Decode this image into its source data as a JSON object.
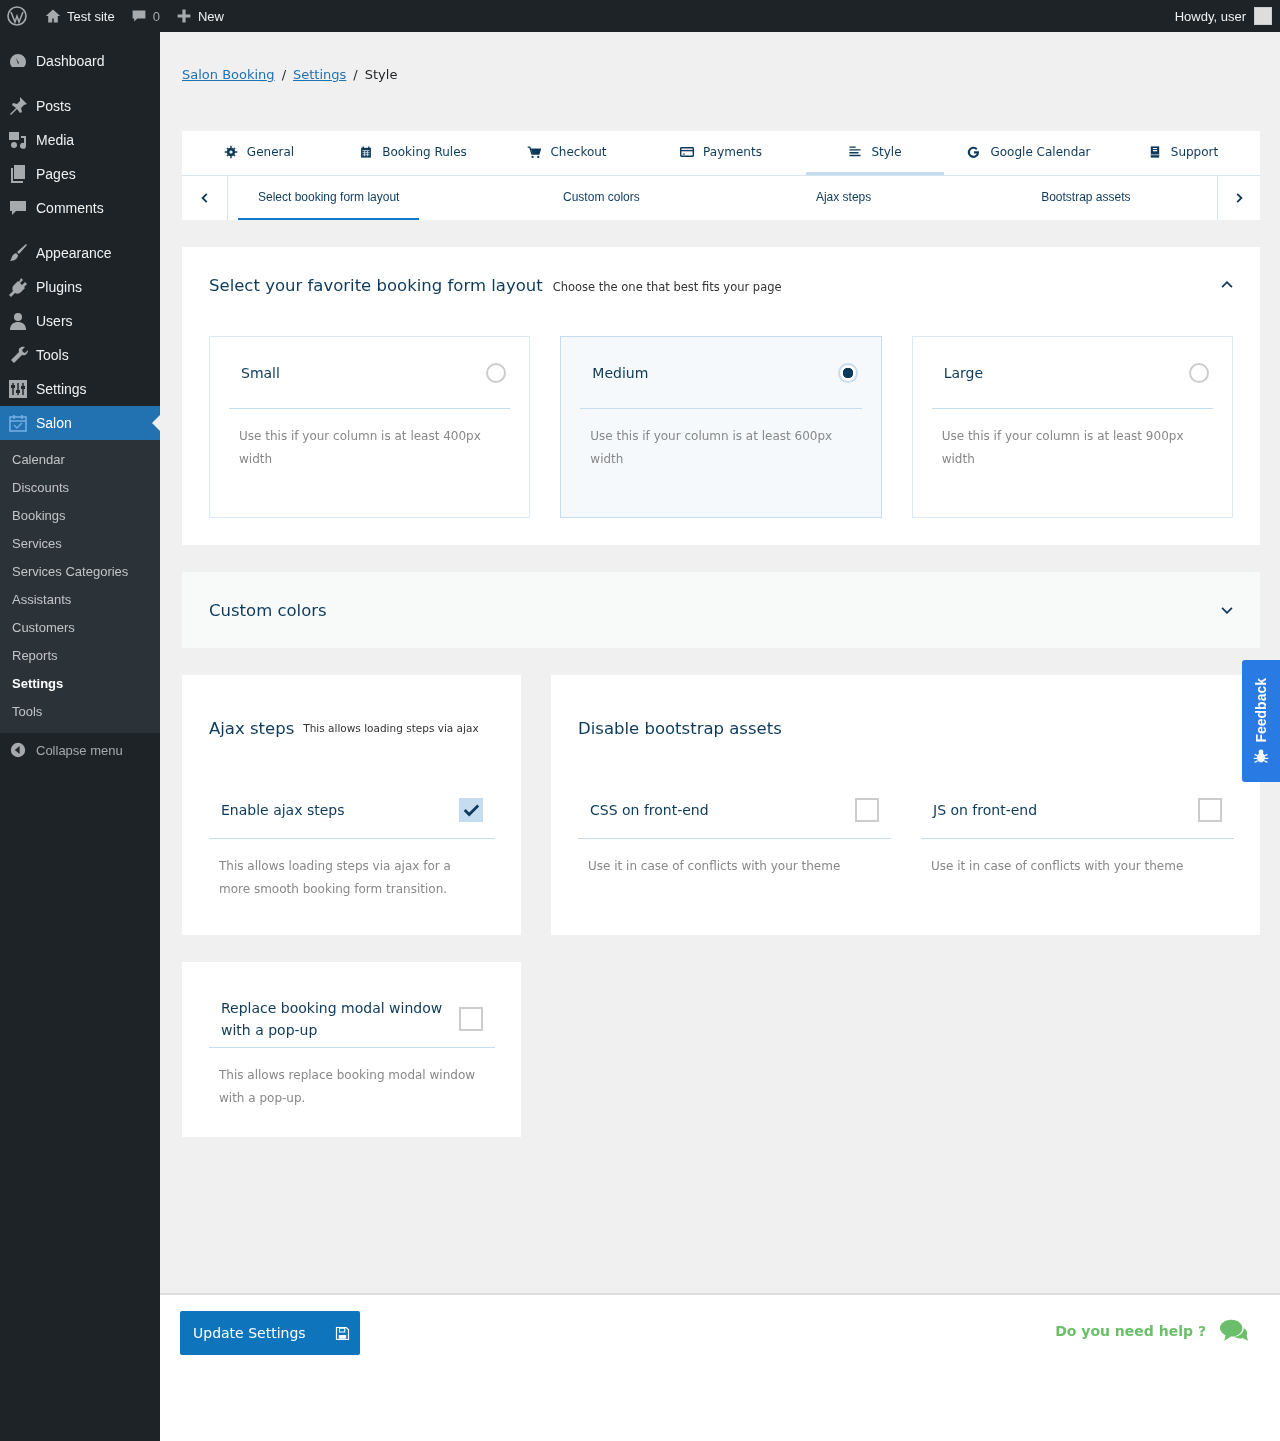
{
  "admin_bar": {
    "site": "Test site",
    "comments": "0",
    "new": "New",
    "greeting": "Howdy, user"
  },
  "sidebar": {
    "groups": [
      [
        {
          "label": "Dashboard",
          "selected": false
        }
      ],
      [
        {
          "label": "Posts",
          "selected": false
        },
        {
          "label": "Media",
          "selected": false
        },
        {
          "label": "Pages",
          "selected": false
        },
        {
          "label": "Comments",
          "selected": false
        }
      ],
      [
        {
          "label": "Appearance",
          "selected": false
        },
        {
          "label": "Plugins",
          "selected": false
        },
        {
          "label": "Users",
          "selected": false
        },
        {
          "label": "Tools",
          "selected": false
        },
        {
          "label": "Settings",
          "selected": false
        },
        {
          "label": "Salon",
          "selected": true,
          "children": [
            {
              "label": "Calendar",
              "selected": false
            },
            {
              "label": "Discounts",
              "selected": false
            },
            {
              "label": "Bookings",
              "selected": false
            },
            {
              "label": "Services",
              "selected": false
            },
            {
              "label": "Services Categories",
              "selected": false
            },
            {
              "label": "Assistants",
              "selected": false
            },
            {
              "label": "Customers",
              "selected": false
            },
            {
              "label": "Reports",
              "selected": false
            },
            {
              "label": "Settings",
              "selected": true
            },
            {
              "label": "Tools",
              "selected": false
            }
          ]
        }
      ]
    ],
    "collapse": "Collapse menu"
  },
  "breadcrumb": {
    "items": [
      {
        "label": "Salon Booking",
        "kind": "link"
      },
      {
        "label": "Settings",
        "kind": "link"
      },
      {
        "label": "Style",
        "kind": "current"
      }
    ],
    "separators": [
      "/",
      "/"
    ]
  },
  "tabs": [
    {
      "label": "General",
      "selected": false
    },
    {
      "label": "Booking Rules",
      "selected": false
    },
    {
      "label": "Checkout",
      "selected": false
    },
    {
      "label": "Payments",
      "selected": false
    },
    {
      "label": "Style",
      "selected": true
    },
    {
      "label": "Google Calendar",
      "selected": false
    },
    {
      "label": "Support",
      "selected": false
    }
  ],
  "subtabs": [
    {
      "label": "Select booking form layout",
      "selected": true
    },
    {
      "label": "Custom colors",
      "selected": false
    },
    {
      "label": "Ajax steps",
      "selected": false
    },
    {
      "label": "Bootstrap assets",
      "selected": false
    }
  ],
  "layout_section": {
    "title": "Select your favorite booking form layout",
    "subtitle": "Choose the one that best fits your page",
    "expanded": true,
    "options": [
      {
        "label": "Small",
        "description": "Use this if your column is at least 400px width",
        "selected": false
      },
      {
        "label": "Medium",
        "description": "Use this if your column is at least 600px width",
        "selected": true
      },
      {
        "label": "Large",
        "description": "Use this if your column is at least 900px width",
        "selected": false
      }
    ]
  },
  "colors_section": {
    "title": "Custom colors",
    "expanded": false
  },
  "ajax_section": {
    "title": "Ajax steps",
    "subtitle": "This allows loading steps via ajax",
    "options": [
      {
        "label": "Enable ajax steps",
        "checked": true,
        "description": "This allows loading steps via ajax for a more smooth booking form transition."
      }
    ]
  },
  "bootstrap_section": {
    "title": "Disable bootstrap assets",
    "options": [
      {
        "label": "CSS on front-end",
        "checked": false,
        "description": "Use it in case of conflicts with your theme"
      },
      {
        "label": "JS on front-end",
        "checked": false,
        "description": "Use it in case of conflicts with your theme"
      }
    ]
  },
  "popup_section": {
    "options": [
      {
        "label": "Replace booking modal window with a pop-up",
        "checked": false,
        "description": "This allows replace booking modal window with a pop-up."
      }
    ]
  },
  "footer": {
    "button": "Update Settings",
    "help": "Do you need help ?"
  },
  "feedback": "Feedback"
}
